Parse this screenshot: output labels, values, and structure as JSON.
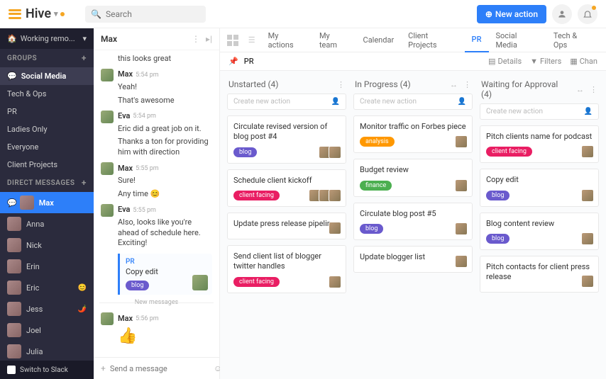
{
  "header": {
    "logo": "Hive",
    "search_placeholder": "Search",
    "new_action": "New action"
  },
  "sidebar": {
    "status": "Working remo...",
    "groups_header": "GROUPS",
    "groups": [
      {
        "label": "Social Media",
        "emoji": "💬",
        "active": true
      },
      {
        "label": "Tech & Ops"
      },
      {
        "label": "PR"
      },
      {
        "label": "Ladies Only"
      },
      {
        "label": "Everyone"
      },
      {
        "label": "Client Projects"
      }
    ],
    "dm_header": "DIRECT MESSAGES",
    "dms": [
      {
        "label": "Max",
        "active": true,
        "badge": "💬"
      },
      {
        "label": "Anna"
      },
      {
        "label": "Nick"
      },
      {
        "label": "Erin"
      },
      {
        "label": "Eric",
        "tail": "😊"
      },
      {
        "label": "Jess",
        "tail": "🌶️"
      },
      {
        "label": "Joel"
      },
      {
        "label": "Julia"
      }
    ],
    "slack": "Switch to Slack"
  },
  "chat": {
    "title": "Max",
    "messages": [
      {
        "type": "cont",
        "text": "this looks great"
      },
      {
        "type": "msg",
        "name": "Max",
        "time": "5:54 pm",
        "text": "Yeah!"
      },
      {
        "type": "cont",
        "text": "That's awesome"
      },
      {
        "type": "msg",
        "name": "Eva",
        "time": "5:54 pm",
        "text": "Eric did a great job on it."
      },
      {
        "type": "cont",
        "text": "Thanks a ton for providing him with direction"
      },
      {
        "type": "msg",
        "name": "Max",
        "time": "5:55 pm",
        "text": "Sure!"
      },
      {
        "type": "cont",
        "text": "Any time 😊"
      },
      {
        "type": "msg",
        "name": "Eva",
        "time": "5:55 pm",
        "text": "Also, looks like you're ahead of schedule here. Exciting!"
      },
      {
        "type": "card",
        "proj": "PR",
        "title": "Copy edit",
        "pill": "blog"
      },
      {
        "type": "div",
        "text": "New messages"
      },
      {
        "type": "msg",
        "name": "Max",
        "time": "5:56 pm",
        "thumbs": true
      }
    ],
    "input_placeholder": "Send a message"
  },
  "tabs": [
    "My actions",
    "My team",
    "Calendar",
    "Client Projects",
    "PR",
    "Social Media",
    "Tech & Ops"
  ],
  "active_tab": "PR",
  "subbar": {
    "project": "PR",
    "details": "Details",
    "filters": "Filters",
    "change": "Chan"
  },
  "columns": [
    {
      "title": "Unstarted",
      "count": 4,
      "icons": [
        "⋮"
      ],
      "cards": [
        {
          "title": "Circulate revised version of blog post #4",
          "pill": "blog",
          "avs": 2
        },
        {
          "title": "Schedule client kickoff",
          "pill": "client facing",
          "avs": 3
        },
        {
          "title": "Update press release pipeline",
          "avs": 1
        },
        {
          "title": "Send client list of blogger twitter handles",
          "pill": "client facing",
          "avs": 1
        }
      ]
    },
    {
      "title": "In Progress",
      "count": 4,
      "icons": [
        "↔",
        "⋮"
      ],
      "cards": [
        {
          "title": "Monitor traffic on Forbes piece",
          "pill": "analysis",
          "avs": 1
        },
        {
          "title": "Budget review",
          "pill": "finance",
          "avs": 1
        },
        {
          "title": "Circulate blog post #5",
          "pill": "blog",
          "avs": 1
        },
        {
          "title": "Update blogger list",
          "avs": 1
        }
      ]
    },
    {
      "title": "Waiting for Approval",
      "count": 4,
      "icons": [
        "↔",
        "⋮"
      ],
      "cards": [
        {
          "title": "Pitch clients name for podcast",
          "pill": "client facing",
          "avs": 1
        },
        {
          "title": "Copy edit",
          "pill": "blog",
          "avs": 1
        },
        {
          "title": "Blog content review",
          "pill": "blog",
          "avs": 1
        },
        {
          "title": "Pitch contacts for client press release",
          "avs": 1
        }
      ]
    }
  ],
  "new_card_placeholder": "Create new action"
}
